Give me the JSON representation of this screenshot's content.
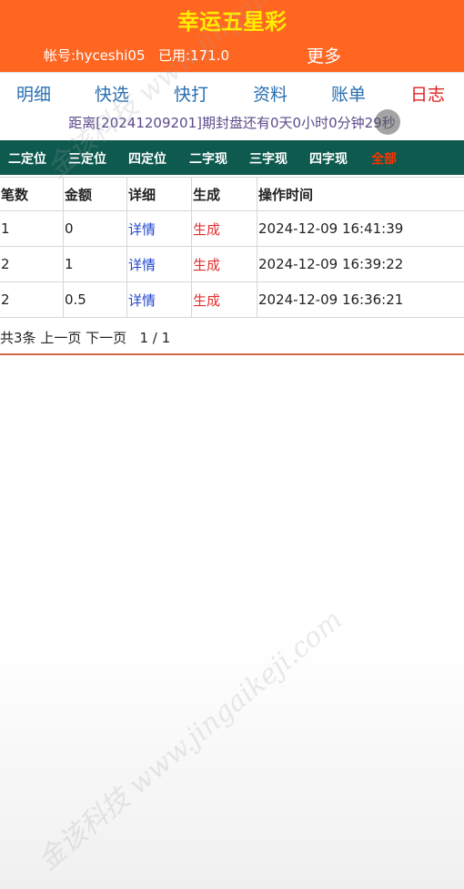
{
  "header": {
    "title": "幸运五星彩",
    "account": "帐号:hyceshi05",
    "used": "已用:171.0",
    "more": "更多"
  },
  "nav": [
    "明细",
    "快选",
    "快打",
    "资料",
    "账单",
    "日志"
  ],
  "countdown": "距离[20241209201]期封盘还有0天0小时0分钟29秒",
  "tabs": [
    "二定位",
    "三定位",
    "四定位",
    "二字现",
    "三字现",
    "四字现",
    "全部"
  ],
  "table": {
    "headers": [
      "笔数",
      "金额",
      "详细",
      "生成",
      "操作时间"
    ],
    "rows": [
      {
        "count": "1",
        "amount": "0",
        "detail": "详情",
        "gen": "生成",
        "time": "2024-12-09 16:41:39"
      },
      {
        "count": "2",
        "amount": "1",
        "detail": "详情",
        "gen": "生成",
        "time": "2024-12-09 16:39:22"
      },
      {
        "count": "2",
        "amount": "0.5",
        "detail": "详情",
        "gen": "生成",
        "time": "2024-12-09 16:36:21"
      }
    ]
  },
  "pager": {
    "total": "共3条",
    "prev": "上一页",
    "next": "下一页",
    "page": "1 / 1"
  },
  "watermark": {
    "line1": "金该科技 www.jingaikeji.com"
  },
  "colors": {
    "header_bg": "#ff6622",
    "title": "#ffee00",
    "tabs_bg": "#0e5a4e",
    "active": "#e02020",
    "link": "#2244cc"
  }
}
